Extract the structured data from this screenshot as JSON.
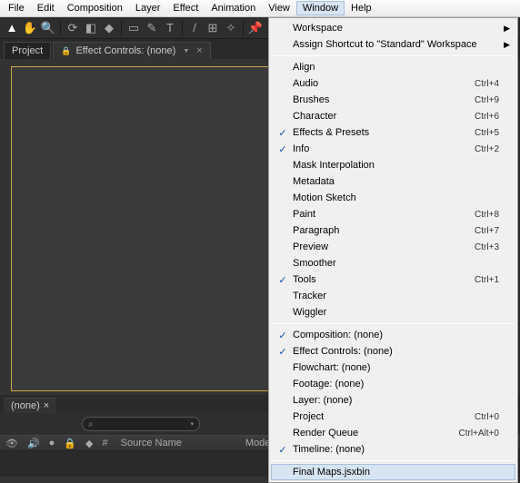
{
  "menubar": [
    "File",
    "Edit",
    "Composition",
    "Layer",
    "Effect",
    "Animation",
    "View",
    "Window",
    "Help"
  ],
  "menubar_open_index": 7,
  "tabs": {
    "project": "Project",
    "effect_controls": "Effect Controls: (none)"
  },
  "bottom_tab": "(none)",
  "search_placeholder": "",
  "timeline": {
    "col_num": "#",
    "col_source": "Source Name",
    "col_mode": "Mode"
  },
  "dropdown": {
    "groups": [
      [
        {
          "label": "Workspace",
          "check": false,
          "shortcut": "",
          "submenu": true
        },
        {
          "label": "Assign Shortcut to \"Standard\" Workspace",
          "check": false,
          "shortcut": "",
          "submenu": true
        }
      ],
      [
        {
          "label": "Align",
          "check": false,
          "shortcut": ""
        },
        {
          "label": "Audio",
          "check": false,
          "shortcut": "Ctrl+4"
        },
        {
          "label": "Brushes",
          "check": false,
          "shortcut": "Ctrl+9"
        },
        {
          "label": "Character",
          "check": false,
          "shortcut": "Ctrl+6"
        },
        {
          "label": "Effects & Presets",
          "check": true,
          "shortcut": "Ctrl+5"
        },
        {
          "label": "Info",
          "check": true,
          "shortcut": "Ctrl+2"
        },
        {
          "label": "Mask Interpolation",
          "check": false,
          "shortcut": ""
        },
        {
          "label": "Metadata",
          "check": false,
          "shortcut": ""
        },
        {
          "label": "Motion Sketch",
          "check": false,
          "shortcut": ""
        },
        {
          "label": "Paint",
          "check": false,
          "shortcut": "Ctrl+8"
        },
        {
          "label": "Paragraph",
          "check": false,
          "shortcut": "Ctrl+7"
        },
        {
          "label": "Preview",
          "check": false,
          "shortcut": "Ctrl+3"
        },
        {
          "label": "Smoother",
          "check": false,
          "shortcut": ""
        },
        {
          "label": "Tools",
          "check": true,
          "shortcut": "Ctrl+1"
        },
        {
          "label": "Tracker",
          "check": false,
          "shortcut": ""
        },
        {
          "label": "Wiggler",
          "check": false,
          "shortcut": ""
        }
      ],
      [
        {
          "label": "Composition: (none)",
          "check": true,
          "shortcut": ""
        },
        {
          "label": "Effect Controls: (none)",
          "check": true,
          "shortcut": ""
        },
        {
          "label": "Flowchart: (none)",
          "check": false,
          "shortcut": ""
        },
        {
          "label": "Footage: (none)",
          "check": false,
          "shortcut": ""
        },
        {
          "label": "Layer: (none)",
          "check": false,
          "shortcut": ""
        },
        {
          "label": "Project",
          "check": false,
          "shortcut": "Ctrl+0"
        },
        {
          "label": "Render Queue",
          "check": false,
          "shortcut": "Ctrl+Alt+0"
        },
        {
          "label": "Timeline: (none)",
          "check": true,
          "shortcut": ""
        }
      ],
      [
        {
          "label": "Final Maps.jsxbin",
          "check": false,
          "shortcut": "",
          "hover": true
        }
      ]
    ]
  }
}
